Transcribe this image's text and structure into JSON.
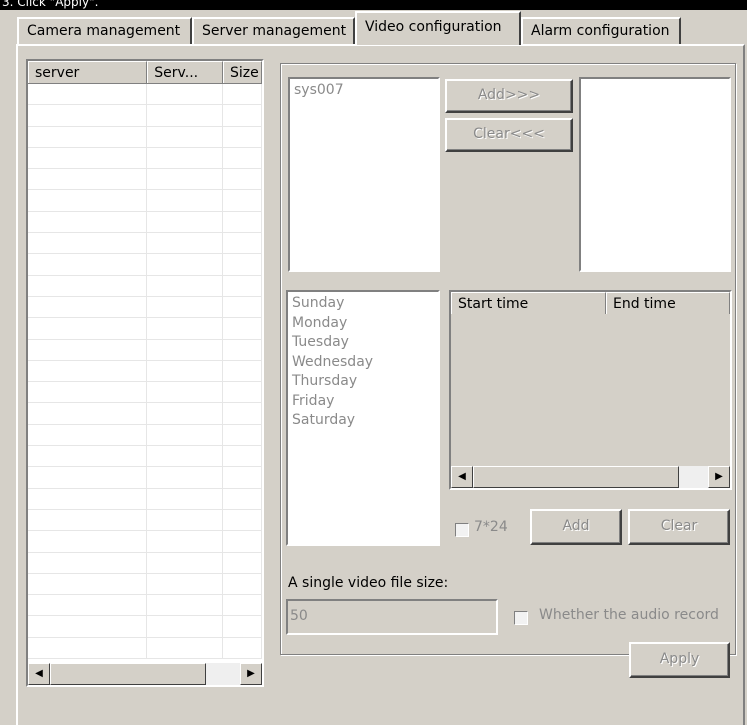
{
  "instruction_snippet": "3. Click \"Apply\".",
  "tabs": [
    {
      "label": "Camera management"
    },
    {
      "label": "Server management"
    },
    {
      "label": "Video configuration"
    },
    {
      "label": "Alarm configuration"
    }
  ],
  "server_grid": {
    "columns": [
      "server",
      "Serv...",
      "Size"
    ]
  },
  "cameras": {
    "available": [
      "sys007"
    ],
    "add_label": "Add>>>",
    "clear_label": "Clear<<<"
  },
  "schedule": {
    "days": [
      "Sunday",
      "Monday",
      "Tuesday",
      "Wednesday",
      "Thursday",
      "Friday",
      "Saturday"
    ],
    "columns": [
      "Start time",
      "End time"
    ],
    "always_label": "7*24",
    "add_label": "Add",
    "clear_label": "Clear"
  },
  "file_size": {
    "label": "A single video file size:",
    "value": "50"
  },
  "audio_label": "Whether the audio record",
  "apply_label": "Apply"
}
